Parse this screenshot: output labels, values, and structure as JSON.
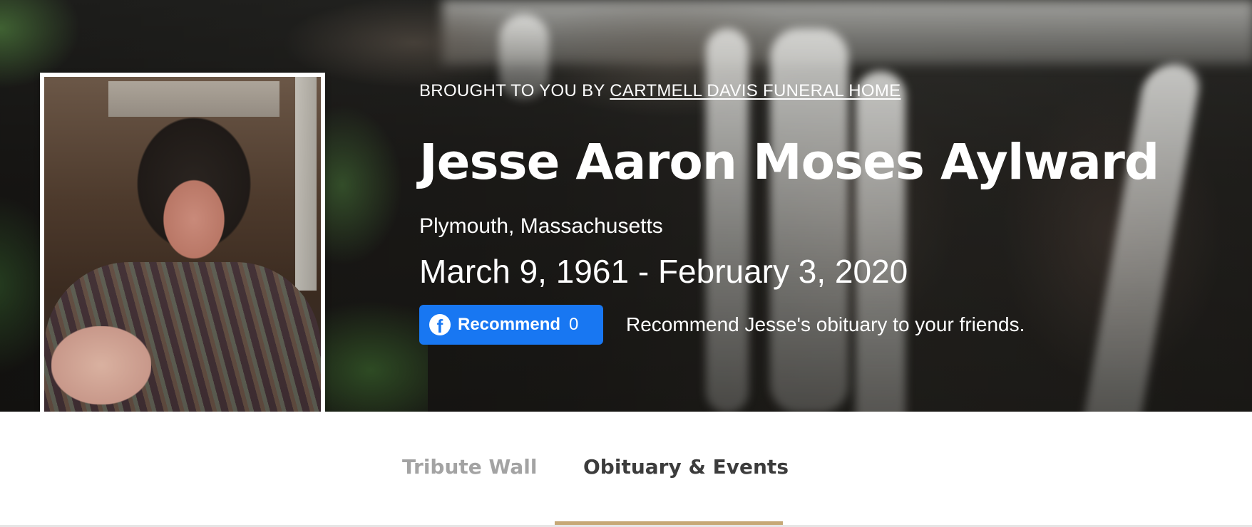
{
  "header": {
    "brought_prefix": "BROUGHT TO YOU BY ",
    "funeral_home_link": "CARTMELL DAVIS FUNERAL HOME",
    "name": "Jesse Aaron Moses Aylward",
    "location": "Plymouth, Massachusetts",
    "dates": "March 9, 1961 - February 3, 2020"
  },
  "recommend": {
    "icon": "facebook-icon",
    "icon_glyph": "f",
    "label": "Recommend",
    "count": "0",
    "message": "Recommend Jesse's obituary to your friends.",
    "button_color": "#1877f2"
  },
  "tabs": [
    {
      "label": "Tribute Wall",
      "active": false
    },
    {
      "label": "Obituary & Events",
      "active": true
    }
  ],
  "colors": {
    "tab_active_underline": "#c6a876",
    "tab_inactive_text": "#a3a3a3",
    "tab_active_text": "#3c3c3c"
  }
}
